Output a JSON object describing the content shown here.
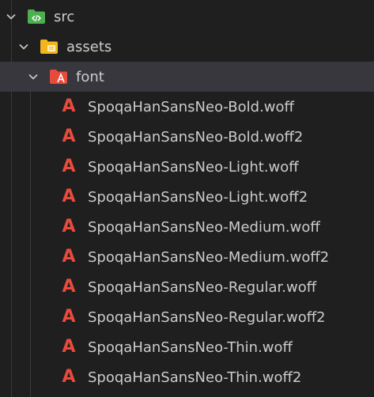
{
  "explorer": {
    "src": {
      "label": "src",
      "icon": "code-folder-icon",
      "color": "#4caf50"
    },
    "assets": {
      "label": "assets",
      "icon": "assets-folder-icon",
      "color": "#f2b51d"
    },
    "font": {
      "label": "font",
      "icon": "font-folder-icon",
      "color": "#e84b3c"
    },
    "files": [
      {
        "label": "SpoqaHanSansNeo-Bold.woff",
        "icon": "font-file-icon"
      },
      {
        "label": "SpoqaHanSansNeo-Bold.woff2",
        "icon": "font-file-icon"
      },
      {
        "label": "SpoqaHanSansNeo-Light.woff",
        "icon": "font-file-icon"
      },
      {
        "label": "SpoqaHanSansNeo-Light.woff2",
        "icon": "font-file-icon"
      },
      {
        "label": "SpoqaHanSansNeo-Medium.woff",
        "icon": "font-file-icon"
      },
      {
        "label": "SpoqaHanSansNeo-Medium.woff2",
        "icon": "font-file-icon"
      },
      {
        "label": "SpoqaHanSansNeo-Regular.woff",
        "icon": "font-file-icon"
      },
      {
        "label": "SpoqaHanSansNeo-Regular.woff2",
        "icon": "font-file-icon"
      },
      {
        "label": "SpoqaHanSansNeo-Thin.woff",
        "icon": "font-file-icon"
      },
      {
        "label": "SpoqaHanSansNeo-Thin.woff2",
        "icon": "font-file-icon"
      }
    ],
    "glyph": "A",
    "file_icon_color": "#e84b3c",
    "selected_row_color": "#37373d"
  }
}
